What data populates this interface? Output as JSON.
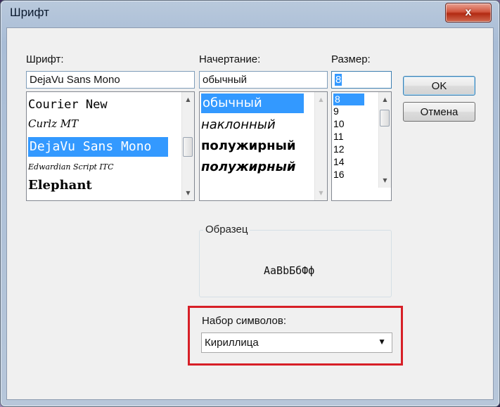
{
  "window": {
    "title": "Шрифт",
    "close_glyph": "x"
  },
  "font": {
    "label": "Шрифт:",
    "value": "DejaVu Sans Mono",
    "items": [
      "Courier New",
      "Curlz MT",
      "DejaVu Sans Mono",
      "Edwardian Script ITC",
      "Elephant"
    ],
    "selected_index": 2
  },
  "style": {
    "label": "Начертание:",
    "value": "обычный",
    "items": [
      "обычный",
      "наклонный",
      "полужирный",
      "полужирный"
    ],
    "selected_index": 0
  },
  "size": {
    "label": "Размер:",
    "value": "8",
    "items": [
      "8",
      "9",
      "10",
      "11",
      "12",
      "14",
      "16"
    ],
    "selected_index": 0
  },
  "buttons": {
    "ok": "OK",
    "cancel": "Отмена"
  },
  "sample": {
    "label": "Образец",
    "text": "AaBbБбФф"
  },
  "charset": {
    "label": "Набор символов:",
    "value": "Кириллица"
  },
  "colors": {
    "selection": "#3399ff",
    "highlight_border": "#d71f27",
    "close_button": "#c8412a"
  },
  "icons": {
    "scroll_up": "scroll-up-icon",
    "scroll_down": "scroll-down-icon",
    "dropdown": "chevron-down-icon",
    "close": "close-icon"
  }
}
